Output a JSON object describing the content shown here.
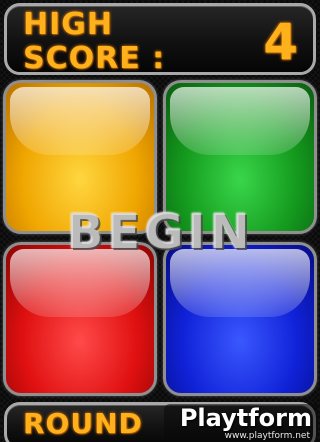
{
  "high_score": {
    "label_line1": "HIGH",
    "label_line2": "SCORE :",
    "value": "4"
  },
  "board": {
    "start_label": "BEGIN",
    "tiles": [
      {
        "name": "yellow",
        "color": "#f0a600"
      },
      {
        "name": "green",
        "color": "#149a1e"
      },
      {
        "name": "red",
        "color": "#e01010"
      },
      {
        "name": "blue",
        "color": "#1022d8"
      }
    ]
  },
  "round": {
    "label": "ROUND"
  },
  "watermark": {
    "brand": "Playtform",
    "url": "www.playtform.net"
  }
}
